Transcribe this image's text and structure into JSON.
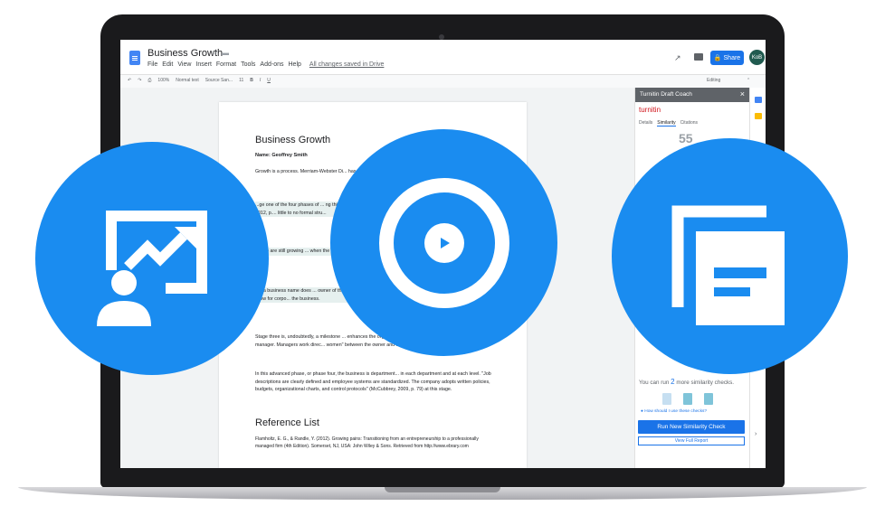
{
  "doc": {
    "title": "Business Growth",
    "menu": [
      "File",
      "Edit",
      "View",
      "Insert",
      "Format",
      "Tools",
      "Add-ons",
      "Help"
    ],
    "saved_status": "All changes saved in Drive",
    "share_label": "Share",
    "avatar_initials": "KoB"
  },
  "toolbar": {
    "zoom": "100%",
    "style": "Normal text",
    "font": "Source San...",
    "size": "11",
    "mode": "Editing"
  },
  "page": {
    "heading": "Business Growth",
    "name_line": "Name: Geoffrey Smith",
    "p1": "Growth is a process. Merriam-Webster Di... has grown\". The growth of a business ... the business.",
    "p2": "...ge one of the four phases of ... ng this stage, the entrepren... operations 'such as market... holtz & Randle, 2012, p.... little to no formal stru...",
    "p3": "...here are still growing ... when the incorporatio... managerial duties suc... le continuing to facilit...",
    "p4": "...g a business name does ... owner of the business is re... business acquires debts, the cre... tructure does not allow for corpo... the business.",
    "p5": "Stage three is, undoubtedly, a milestone ... enhances the organizational structure, but a... an employee, or manager. Managers work direc... women\" between the owner and the workers.",
    "p6": "In this advanced phase, or phase four, the business is department... in each department and at each level. \"Job descriptions are clearly defined and employee systems are standardized. The company adopts written policies, budgets, organizational charts, and control protocols\" (McCubbrey, 2009, p. 79) at this stage.",
    "refs_heading": "Reference List",
    "ref1": "Flamholtz, E. G., & Randle, Y. (2012). Growing pains: Transitioning from an entrepreneurship to a professionally managed firm (4th Edition). Somerset, NJ, USA: John Wiley & Sons. Retrieved from http://www.ebrary.com"
  },
  "turnitin": {
    "title": "Turnitin Draft Coach",
    "logo": "turnitin",
    "tabs": [
      "Details",
      "Similarity",
      "Citations"
    ],
    "score_partial": "55",
    "runs_prefix": "You can run",
    "runs_count": "2",
    "runs_suffix": "more similarity checks.",
    "help_link": "How should I use these checks?",
    "run_button": "Run New Similarity Check",
    "report_button": "View Full Report"
  },
  "colors": {
    "accent": "#1a8cf0",
    "google_blue": "#1a73e8",
    "turnitin_red": "#d0141b"
  },
  "icons": [
    "presentation-growth-icon",
    "play-icon",
    "documents-icon"
  ]
}
